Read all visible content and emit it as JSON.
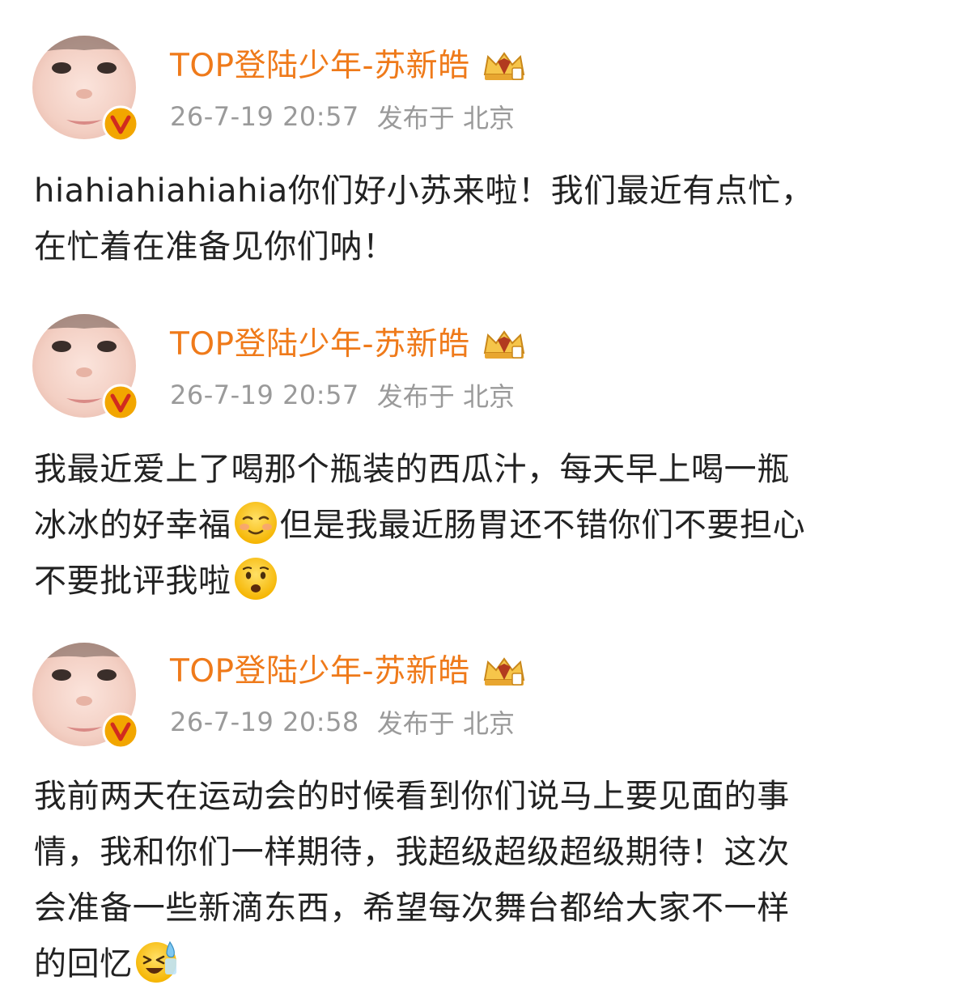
{
  "posts": [
    {
      "username": "TOP登陆少年-苏新皓",
      "time": "26-7-19 20:57",
      "location": "发布于 北京",
      "lines": [
        "hiahiahiahiahia你们好小苏来啦！我们最近有点忙，",
        "在忙着在准备见你们呐！"
      ]
    },
    {
      "username": "TOP登陆少年-苏新皓",
      "time": "26-7-19 20:57",
      "location": "发布于 北京",
      "line1": "我最近爱上了喝那个瓶装的西瓜汁，每天早上喝一瓶",
      "line2_a": "冰冰的好幸福",
      "line2_b": "但是我最近肠胃还不错你们不要担心",
      "line3": "不要批评我啦",
      "emoji_1": "smiling-blush-emoji",
      "emoji_2": "anguished-face-emoji"
    },
    {
      "username": "TOP登陆少年-苏新皓",
      "time": "26-7-19 20:58",
      "location": "发布于 北京",
      "lines": [
        "我前两天在运动会的时候看到你们说马上要见面的事",
        "情，我和你们一样期待，我超级超级超级期待！这次",
        "会准备一些新滴东西，希望每次舞台都给大家不一样"
      ],
      "last_line": "的回忆",
      "emoji": "cold-sweat-laughing-emoji"
    }
  ],
  "colors": {
    "username": "#ef7a1a",
    "meta": "#9a9a9a",
    "text": "#222222",
    "badge": "#f2a600"
  }
}
